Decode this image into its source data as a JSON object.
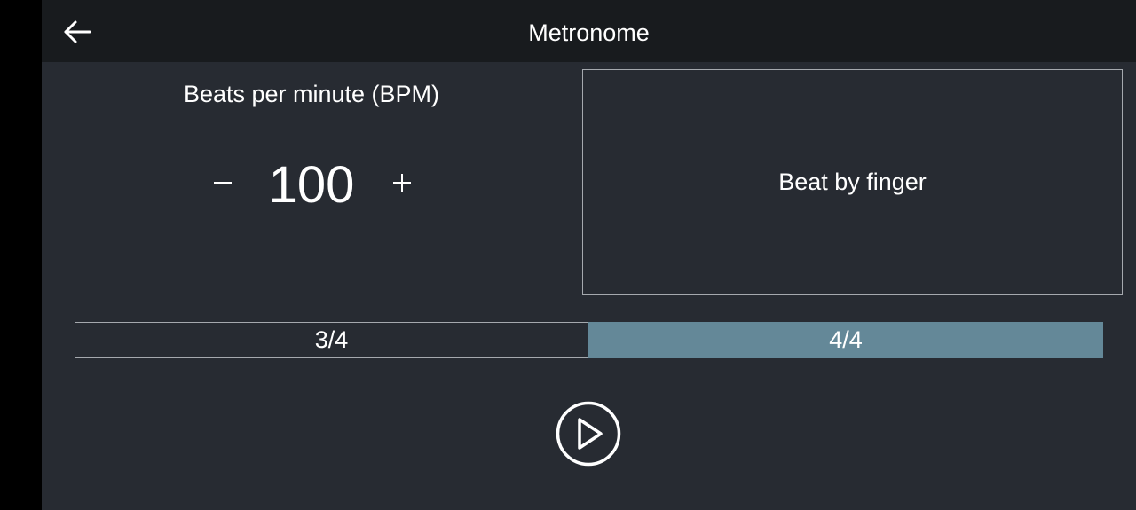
{
  "app_bar": {
    "title": "Metronome",
    "back_icon": "arrow-left-icon"
  },
  "bpm": {
    "label": "Beats per minute (BPM)",
    "value": "100",
    "decrement_icon": "minus-icon",
    "increment_icon": "plus-icon"
  },
  "beat_pad": {
    "label": "Beat by finger"
  },
  "time_signature": {
    "options": [
      {
        "label": "3/4",
        "selected": false
      },
      {
        "label": "4/4",
        "selected": true
      }
    ]
  },
  "playback": {
    "play_icon": "play-circle-icon"
  },
  "colors": {
    "background": "#272b32",
    "app_bar": "#181b1e",
    "selected_segment": "#648898",
    "outline": "#a5a9ae"
  }
}
